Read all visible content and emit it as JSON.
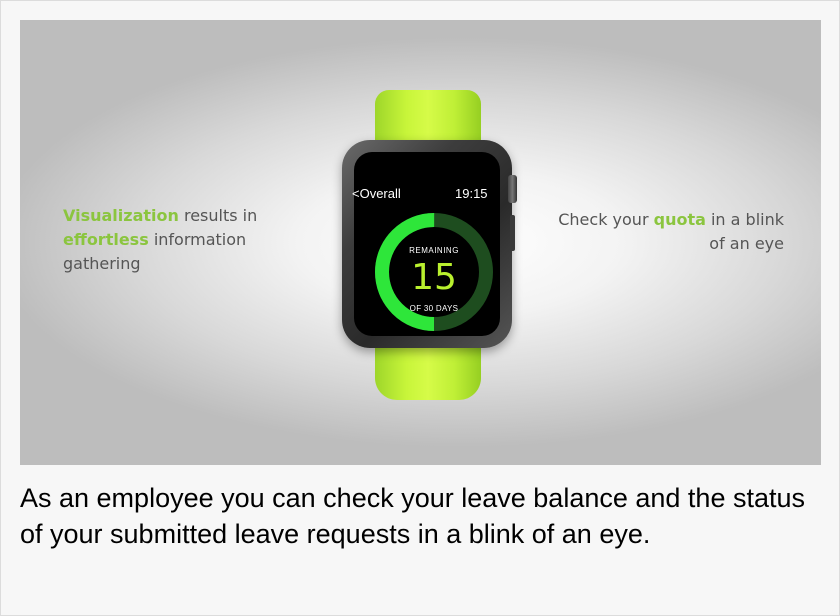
{
  "hero": {
    "left": {
      "word1": "Visualization",
      "text1": " results in ",
      "word2": "effortless",
      "text2": " information gathering"
    },
    "right": {
      "text1": "Check your ",
      "word": "quota",
      "text2": " in a blink of an eye"
    },
    "watch": {
      "nav_back": "<Overall",
      "time": "19:15",
      "remaining_label": "REMAINING",
      "remaining_value": "15",
      "total_label": "OF 30 DAYS",
      "progress_fraction": 0.5,
      "colors": {
        "ring_bright": "#2ee63a",
        "ring_dark": "#1e4d1f",
        "value": "#b9f02e",
        "strap": "#c8f53a"
      }
    },
    "highlight_color": "#8bc53f"
  },
  "caption": "As an employee you can check your leave balance and the status of your submitted leave requests in a blink of an eye."
}
